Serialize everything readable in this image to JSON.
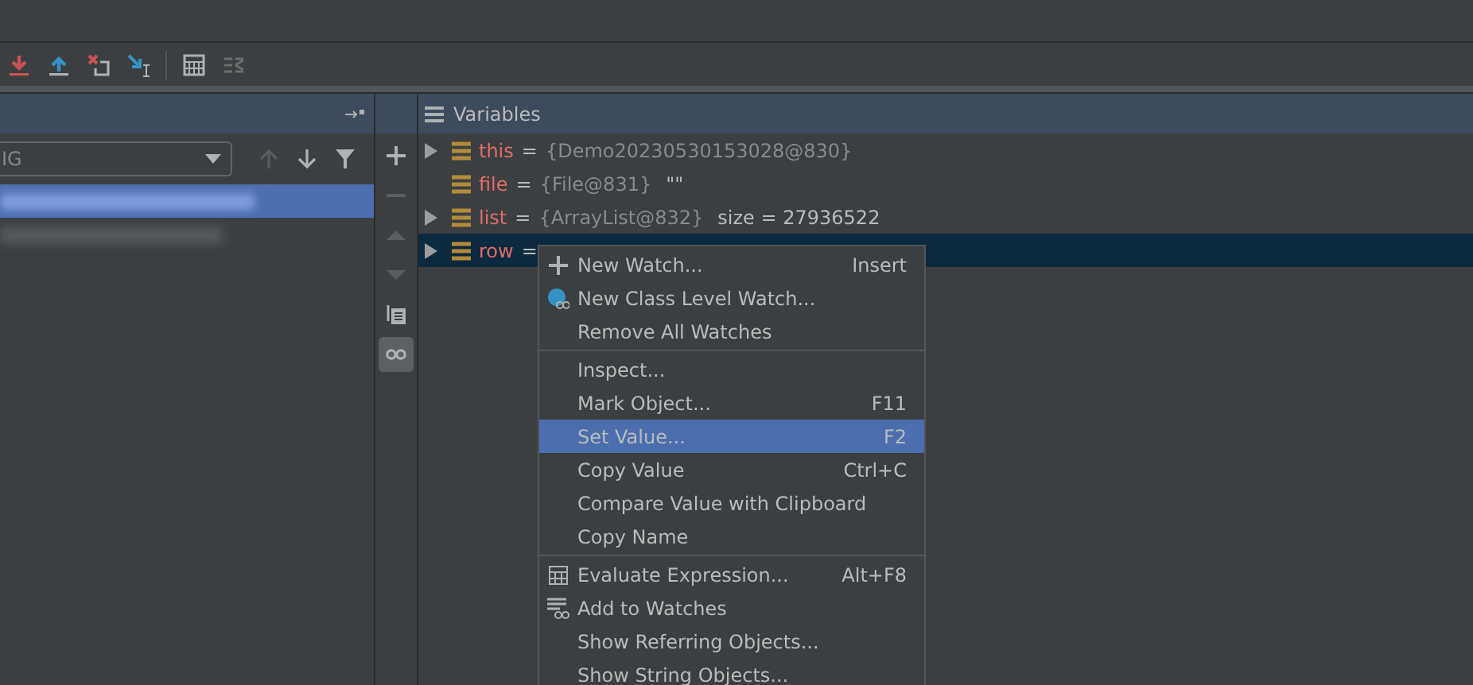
{
  "frames_panel": {
    "dropdown": {
      "value": "IG"
    },
    "nav": [
      {
        "kind": "up",
        "disabled": true
      },
      {
        "kind": "down",
        "disabled": false
      },
      {
        "kind": "filter",
        "disabled": false
      }
    ],
    "frames": [
      {
        "selected": true
      },
      {
        "selected": false
      }
    ]
  },
  "side_toolbar": [
    {
      "kind": "plus",
      "disabled": false,
      "on": false
    },
    {
      "kind": "minus",
      "disabled": true,
      "on": false
    },
    {
      "kind": "up",
      "disabled": true,
      "on": false
    },
    {
      "kind": "down",
      "disabled": true,
      "on": false
    },
    {
      "kind": "copy",
      "disabled": false,
      "on": false
    },
    {
      "kind": "glasses",
      "disabled": false,
      "on": true
    }
  ],
  "variables": {
    "title": "Variables",
    "rows": [
      {
        "name": "this",
        "equals": "=",
        "value": "{Demo20230530153028@830}",
        "expandable": true,
        "selected": false
      },
      {
        "name": "file",
        "equals": "=",
        "value": "{File@831}",
        "extra": "\"\"",
        "expandable": false,
        "selected": false
      },
      {
        "name": "list",
        "equals": "=",
        "value": "{ArrayList@832}",
        "extra": "size = 27936522",
        "expandable": true,
        "selected": false
      },
      {
        "name": "row",
        "equals": "=",
        "expandable": true,
        "selected": true
      }
    ]
  },
  "context_menu": {
    "groups": [
      [
        {
          "label": "New Watch...",
          "shortcut": "Insert",
          "kind": "plus",
          "selected": false
        },
        {
          "label": "New Class Level Watch...",
          "kind": "class-watch",
          "selected": false
        },
        {
          "label": "Remove All Watches",
          "kind": "plain",
          "selected": false
        }
      ],
      [
        {
          "label": "Inspect...",
          "kind": "plain",
          "selected": false
        },
        {
          "label": "Mark Object...",
          "shortcut": "F11",
          "kind": "plain",
          "selected": false
        },
        {
          "label": "Set Value...",
          "shortcut": "F2",
          "kind": "plain",
          "selected": true
        },
        {
          "label": "Copy Value",
          "shortcut": "Ctrl+C",
          "kind": "plain",
          "selected": false
        },
        {
          "label": "Compare Value with Clipboard",
          "kind": "plain",
          "selected": false
        },
        {
          "label": "Copy Name",
          "kind": "plain",
          "selected": false
        }
      ],
      [
        {
          "label": "Evaluate Expression...",
          "shortcut": "Alt+F8",
          "kind": "calculator",
          "selected": false
        },
        {
          "label": "Add to Watches",
          "kind": "add-watches",
          "selected": false
        },
        {
          "label": "Show Referring Objects...",
          "kind": "plain",
          "selected": false
        },
        {
          "label": "Show String Objects...",
          "kind": "plain",
          "selected": false
        }
      ]
    ]
  }
}
